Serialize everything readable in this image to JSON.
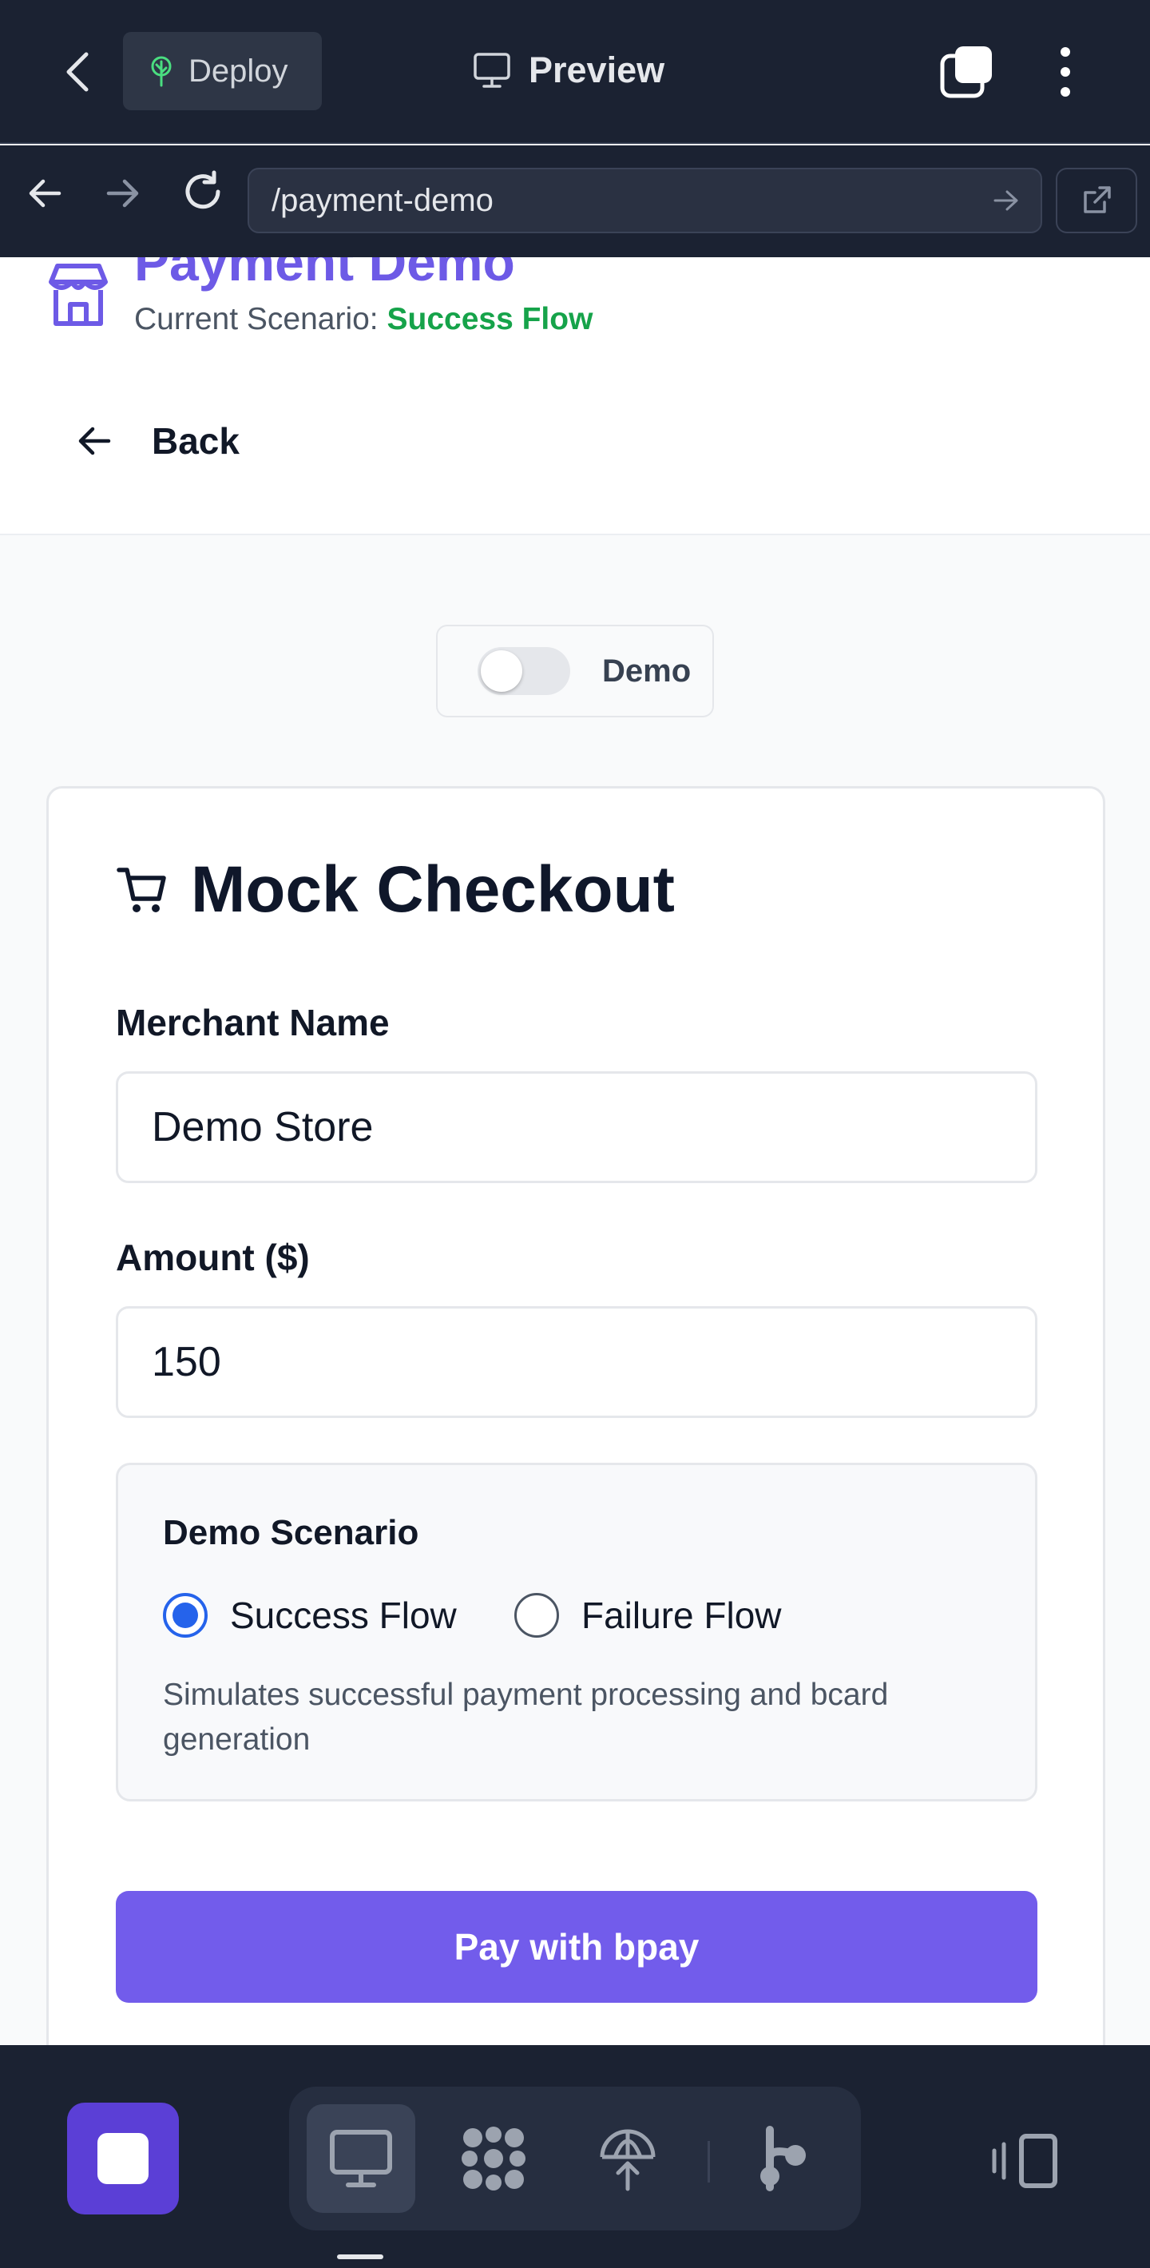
{
  "browser": {
    "deploy_label": "Deploy",
    "preview_label": "Preview",
    "url": "/payment-demo"
  },
  "header": {
    "app_title": "Payment Demo",
    "scenario_prefix": "Current Scenario:",
    "scenario_value": "Success Flow",
    "back_label": "Back"
  },
  "demo_toggle": {
    "label": "Demo",
    "enabled": false
  },
  "checkout": {
    "title": "Mock Checkout",
    "merchant_label": "Merchant Name",
    "merchant_value": "Demo Store",
    "amount_label": "Amount ($)",
    "amount_value": "150",
    "scenario_title": "Demo Scenario",
    "options": [
      {
        "label": "Success Flow",
        "selected": true
      },
      {
        "label": "Failure Flow",
        "selected": false
      }
    ],
    "scenario_description": "Simulates successful payment processing and bcard generation",
    "pay_label": "Pay with bpay"
  },
  "colors": {
    "accent": "#725ceb",
    "success": "#16a34a",
    "chrome_bg": "#1b2232"
  },
  "icons": {
    "top": [
      "chevron-left-icon",
      "tree-icon",
      "monitor-icon",
      "tabs-icon",
      "more-vertical-icon"
    ],
    "url": [
      "arrow-left-icon",
      "arrow-right-icon",
      "reload-icon",
      "arrow-right-icon",
      "external-link-icon"
    ],
    "bottom": [
      "stop-icon",
      "monitor-icon",
      "grid-dots-icon",
      "globe-upload-icon",
      "branch-icon",
      "layout-icon"
    ]
  }
}
